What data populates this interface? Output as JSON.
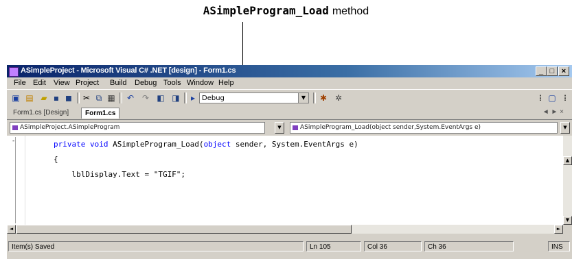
{
  "annotation": {
    "method_name": "ASimpleProgram_Load",
    "suffix": "method"
  },
  "window": {
    "title": "ASimpleProject - Microsoft Visual C# .NET [design] - Form1.cs",
    "controls": {
      "minimize": "_",
      "maximize": "□",
      "close": "×"
    }
  },
  "menu": {
    "items": [
      "File",
      "Edit",
      "View",
      "Project",
      "Build",
      "Debug",
      "Tools",
      "Window",
      "Help"
    ]
  },
  "toolbar": {
    "config_combo": "Debug",
    "icons": [
      "new-project-icon",
      "add-item-icon",
      "open-icon",
      "save-icon",
      "save-all-icon",
      "cut-icon",
      "copy-icon",
      "paste-icon",
      "undo-icon",
      "redo-icon",
      "navigate-back-icon",
      "navigate-forward-icon",
      "start-icon",
      "find-icon",
      "solution-explorer-icon",
      "properties-icon"
    ]
  },
  "tabs": {
    "items": [
      {
        "label": "Form1.cs [Design]",
        "active": false
      },
      {
        "label": "Form1.cs",
        "active": true
      }
    ],
    "close_label": "◄ ► ×"
  },
  "nav": {
    "class_combo": "ASimpleProject.ASimpleProgram",
    "member_combo": "ASimpleProgram_Load(object sender,System.EventArgs e)"
  },
  "code": {
    "line1": {
      "kw1": "private",
      "kw2": "void",
      "mid": " ASimpleProgram_Load(",
      "kw3": "object",
      "rest": " sender, System.EventArgs e)"
    },
    "line2": "{",
    "line3": "    lblDisplay.Text = \"TGIF\";"
  },
  "status": {
    "ready": "Item(s) Saved",
    "ln": "Ln 105",
    "col": "Col 36",
    "ch": "Ch 36",
    "mode": "INS"
  }
}
